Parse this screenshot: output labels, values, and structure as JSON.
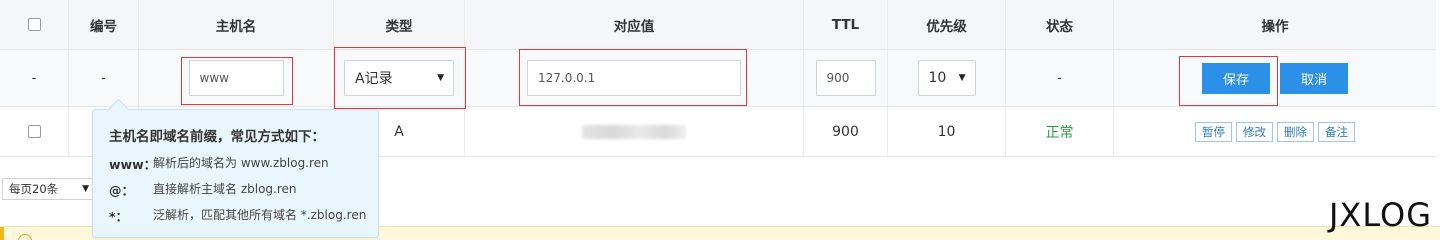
{
  "headers": {
    "number": "编号",
    "hostname": "主机名",
    "type": "类型",
    "value": "对应值",
    "ttl": "TTL",
    "priority": "优先级",
    "status": "状态",
    "actions": "操作"
  },
  "edit_row": {
    "number": "-",
    "dash": "-",
    "hostname_value": "www",
    "type_selected": "A记录",
    "value_input": "127.0.0.1",
    "ttl_input": "900",
    "priority_selected": "10",
    "status": "-",
    "save_label": "保存",
    "cancel_label": "取消"
  },
  "data_row": {
    "type": "A",
    "ttl": "900",
    "priority": "10",
    "status": "正常",
    "actions": [
      "暂停",
      "修改",
      "删除",
      "备注"
    ]
  },
  "pagination": {
    "page_size": "每页20条"
  },
  "tooltip": {
    "title": "主机名即域名前缀，常见方式如下：",
    "lines": [
      {
        "key": "www：",
        "text": "解析后的域名为 www.zblog.ren"
      },
      {
        "key": "@：",
        "text": "直接解析主域名 zblog.ren"
      },
      {
        "key": "*：",
        "text": "泛解析，匹配其他所有域名 *.zblog.ren"
      }
    ]
  },
  "watermark": "JXLOG",
  "colors": {
    "accent": "#2c8fe8",
    "highlight": "#e0383e",
    "status_ok": "#2e9b4a"
  }
}
